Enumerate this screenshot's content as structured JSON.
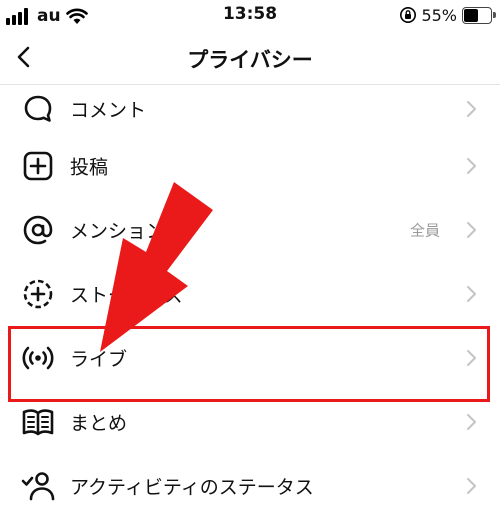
{
  "status_bar": {
    "carrier": "au",
    "time": "13:58",
    "battery_percent": "55%",
    "battery_level": 0.55,
    "icons": [
      "signal-icon",
      "wifi-icon",
      "orientation-lock-icon",
      "battery-icon"
    ]
  },
  "header": {
    "title": "プライバシー",
    "back_icon": "chevron-left-icon"
  },
  "items": [
    {
      "label": "コメント",
      "value": "",
      "icon": "comment-bubble-icon"
    },
    {
      "label": "投稿",
      "value": "",
      "icon": "plus-square-icon"
    },
    {
      "label": "メンション",
      "value": "全員",
      "icon": "at-sign-icon"
    },
    {
      "label": "ストーリーズ",
      "value": "",
      "icon": "story-plus-icon"
    },
    {
      "label": "ライブ",
      "value": "",
      "icon": "live-broadcast-icon"
    },
    {
      "label": "まとめ",
      "value": "",
      "icon": "guides-book-icon"
    },
    {
      "label": "アクティビティのステータス",
      "value": "",
      "icon": "activity-user-check-icon"
    }
  ],
  "annotation": {
    "highlighted_item": "ライブ",
    "color": "#ea1a1a"
  }
}
